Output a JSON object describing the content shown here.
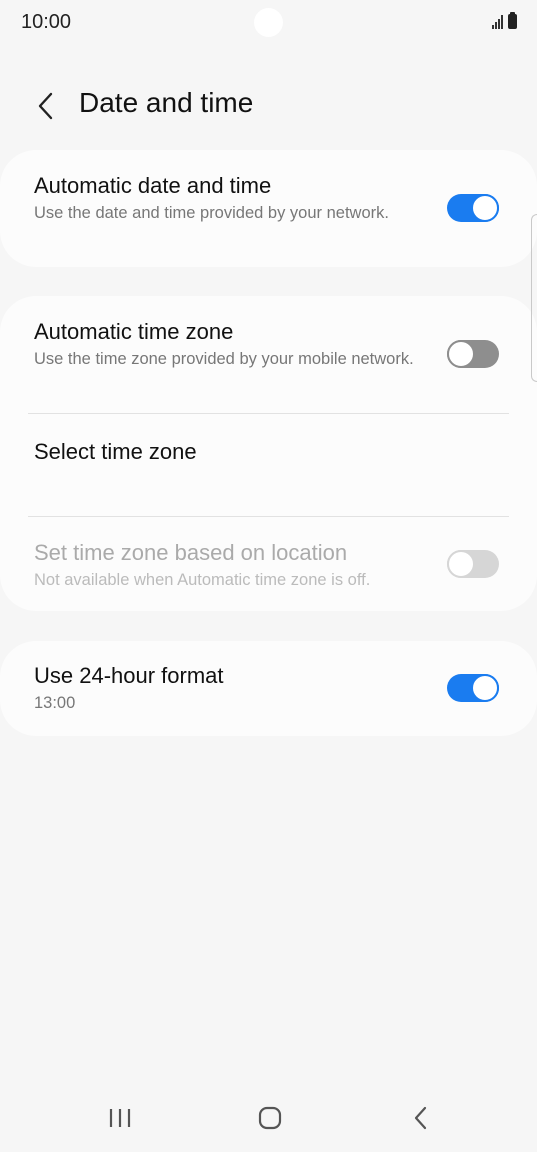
{
  "status_bar": {
    "time": "10:00"
  },
  "header": {
    "title": "Date and time",
    "back_icon": "chevron-left-icon"
  },
  "settings": {
    "automatic_date_time": {
      "title": "Automatic date and time",
      "subtitle": "Use the date and time provided by your network.",
      "enabled": true
    },
    "automatic_time_zone": {
      "title": "Automatic time zone",
      "subtitle": "Use the time zone provided by your mobile network.",
      "enabled": false
    },
    "select_time_zone": {
      "title": "Select time zone"
    },
    "location_time_zone": {
      "title": "Set time zone based on location",
      "subtitle": "Not available when Automatic time zone is off.",
      "enabled": false,
      "disabled": true
    },
    "use_24_hour": {
      "title": "Use 24-hour format",
      "subtitle": "13:00",
      "enabled": true
    }
  },
  "nav": {
    "recents_icon": "recent-apps-icon",
    "home_icon": "home-icon",
    "back_icon": "back-icon"
  },
  "colors": {
    "accent": "#1a7cf0",
    "background": "#f6f6f6",
    "card": "#fcfcfc"
  }
}
